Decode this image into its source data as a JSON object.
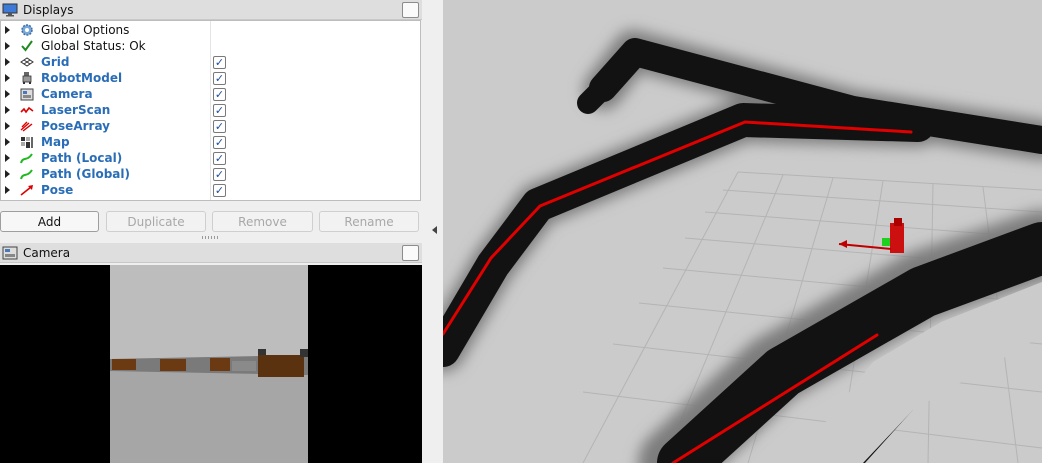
{
  "displays_panel": {
    "title": "Displays",
    "items": [
      {
        "label": "Global Options",
        "icon": "gear-icon",
        "style": "plain",
        "checked": null
      },
      {
        "label": "Global Status: Ok",
        "icon": "checkmark-icon",
        "style": "plain",
        "checked": null
      },
      {
        "label": "Grid",
        "icon": "grid-icon",
        "style": "display",
        "checked": true
      },
      {
        "label": "RobotModel",
        "icon": "robot-model-icon",
        "style": "display",
        "checked": true
      },
      {
        "label": "Camera",
        "icon": "camera-icon",
        "style": "display",
        "checked": true
      },
      {
        "label": "LaserScan",
        "icon": "laser-scan-icon",
        "style": "display",
        "checked": true
      },
      {
        "label": "PoseArray",
        "icon": "pose-array-icon",
        "style": "display",
        "checked": true
      },
      {
        "label": "Map",
        "icon": "map-icon",
        "style": "display",
        "checked": true
      },
      {
        "label": "Path (Local)",
        "icon": "path-local-icon",
        "style": "display",
        "checked": true
      },
      {
        "label": "Path (Global)",
        "icon": "path-global-icon",
        "style": "display",
        "checked": true
      },
      {
        "label": "Pose",
        "icon": "pose-icon",
        "style": "display",
        "checked": true
      }
    ],
    "check_glyph": "✓"
  },
  "buttons": {
    "add": "Add",
    "duplicate": "Duplicate",
    "remove": "Remove",
    "rename": "Rename"
  },
  "camera_panel": {
    "title": "Camera"
  },
  "colors": {
    "display_label": "#2a6db7",
    "laser": "#e00000",
    "wall": "#111111",
    "floor": "#c9c9c9",
    "camera_floor": "#8f8f8f",
    "camera_sky": "#c0c0c0",
    "wall_brown": "#6b3a12"
  }
}
